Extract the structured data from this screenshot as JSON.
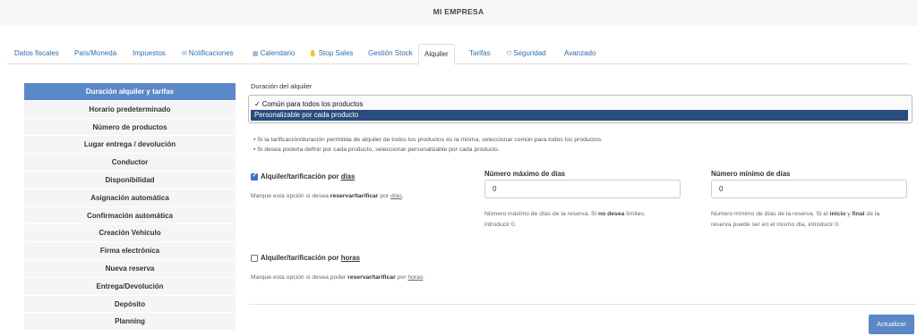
{
  "header": {
    "title": "MI EMPRESA"
  },
  "tabs": [
    {
      "label": "Datos fiscales",
      "icon": "",
      "active": false
    },
    {
      "label": "País/Moneda",
      "icon": "",
      "active": false
    },
    {
      "label": "Impuestos",
      "icon": "",
      "active": false
    },
    {
      "label": "Notificaciones",
      "icon": "envelope-icon",
      "active": false
    },
    {
      "label": "Calendario",
      "icon": "calendar-icon",
      "active": false
    },
    {
      "label": "Stop Sales",
      "icon": "hand-icon",
      "active": false
    },
    {
      "label": "Gestión Stock",
      "icon": "",
      "active": false
    },
    {
      "label": "Alquiler",
      "icon": "",
      "active": true
    },
    {
      "label": "Tarifas",
      "icon": "",
      "active": false
    },
    {
      "label": "Seguridad",
      "icon": "shield-icon",
      "active": false
    },
    {
      "label": "Avanzado",
      "icon": "",
      "active": false
    }
  ],
  "sidebar": {
    "items": [
      {
        "label": "Duración alquiler y tarifas",
        "active": true
      },
      {
        "label": "Horario predeterminado"
      },
      {
        "label": "Número de productos"
      },
      {
        "label": "Lugar entrega / devolución"
      },
      {
        "label": "Conductor"
      },
      {
        "label": "Disponibilidad"
      },
      {
        "label": "Asignación automática"
      },
      {
        "label": "Confirmación automática"
      },
      {
        "label": "Creación Vehículo"
      },
      {
        "label": "Firma electrónica"
      },
      {
        "label": "Nueva reserva"
      },
      {
        "label": "Entrega/Devolución"
      },
      {
        "label": "Depósito"
      },
      {
        "label": "Planning"
      }
    ]
  },
  "duration": {
    "label": "Duración del alquiler",
    "options": [
      "✓ Común para todos los productos",
      "Personalizable por cada producto"
    ],
    "highlighted": "Personalizable por cada producto",
    "hints": [
      "Si la tarificación/duración permitida de alquiler de todos los productos es la misma, seleccionar común para todos los productos.",
      "Si desea poderla definir por cada producto, seleccionar personalizable por cada producto."
    ]
  },
  "days": {
    "checked": true,
    "label_prefix": "Alquiler/tarificación por ",
    "label_unit": "días",
    "help_prefix": "Marque esta opción si desea ",
    "help_bold": "reservar/tarificar",
    "help_mid": " por ",
    "help_unit": "días",
    "help_end": ".",
    "max": {
      "label": "Número máximo de días",
      "value": "0",
      "help_a": "Número máximo de días de la reserva. Si ",
      "help_bold": "no desea",
      "help_b": " límites,",
      "help_c": "introducir 0."
    },
    "min": {
      "label": "Número mínimo de días",
      "value": "0",
      "help_a": "Número mínimo de días de la reserva. Si el ",
      "help_bold1": "inicio",
      "help_b": " y ",
      "help_bold2": "final",
      "help_c": " de la",
      "help_d": "reserva puede ser en el mismo día, introducir 0."
    }
  },
  "hours": {
    "checked": false,
    "label_prefix": "Alquiler/tarificación por ",
    "label_unit": "horas",
    "help_prefix": "Marque esta opción si desea poder ",
    "help_bold": "reservar/tarificar",
    "help_mid": " por ",
    "help_unit": "horas",
    "help_end": "."
  },
  "actions": {
    "update_label": "Actualizar"
  },
  "colors": {
    "accent": "#5b88c6",
    "highlight": "#284c7e",
    "link": "#2e6ea8"
  }
}
